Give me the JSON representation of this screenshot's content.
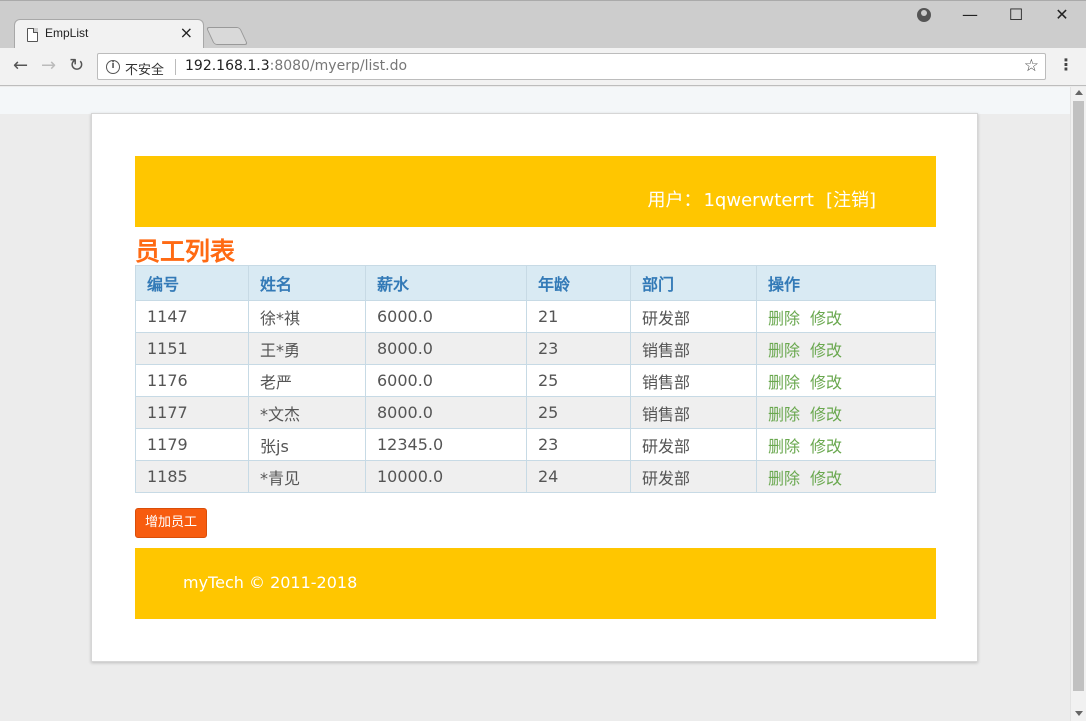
{
  "browser": {
    "tab_title": "EmpList",
    "tab_close": "×",
    "insecure_label": "不安全",
    "url_host": "192.168.1.3",
    "url_rest": ":8080/myerp/list.do",
    "win_min": "—",
    "win_max": "☐",
    "win_close": "✕",
    "back": "←",
    "forward": "→",
    "reload": "↻",
    "star": "☆",
    "menu": "⋮",
    "info": "i"
  },
  "header": {
    "user_prefix": "用户：",
    "username": "1qwerwterrt",
    "logout": "[注销]"
  },
  "page_title": "员工列表",
  "table": {
    "columns": [
      "编号",
      "姓名",
      "薪水",
      "年龄",
      "部门",
      "操作"
    ],
    "rows": [
      {
        "id": "1147",
        "name": "徐*祺",
        "salary": "6000.0",
        "age": "21",
        "dept": "研发部"
      },
      {
        "id": "1151",
        "name": "王*勇",
        "salary": "8000.0",
        "age": "23",
        "dept": "销售部"
      },
      {
        "id": "1176",
        "name": "老严",
        "salary": "6000.0",
        "age": "25",
        "dept": "销售部"
      },
      {
        "id": "1177",
        "name": "*文杰",
        "salary": "8000.0",
        "age": "25",
        "dept": "销售部"
      },
      {
        "id": "1179",
        "name": "张js",
        "salary": "12345.0",
        "age": "23",
        "dept": "研发部"
      },
      {
        "id": "1185",
        "name": "*青见",
        "salary": "10000.0",
        "age": "24",
        "dept": "研发部"
      }
    ],
    "delete_label": "删除",
    "edit_label": "修改"
  },
  "add_button": "增加员工",
  "footer": "myTech © 2011-2018",
  "colors": {
    "header_bg": "#ffc600",
    "title": "#ff6a13",
    "table_header_bg": "#d9eaf3",
    "table_header_text": "#337ab7",
    "action_link": "#6aa84f",
    "add_button": "#f75c0f"
  }
}
